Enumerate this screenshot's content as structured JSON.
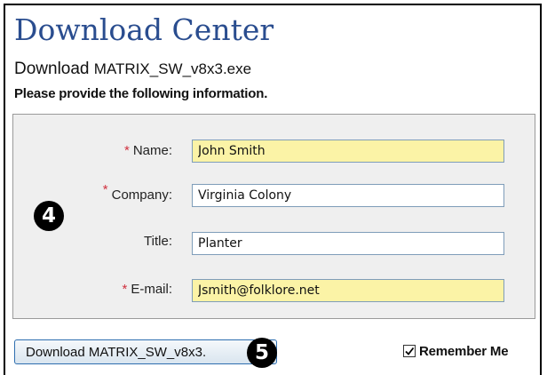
{
  "page": {
    "title": "Download Center",
    "download_prefix": "Download",
    "download_filename": "MATRIX_SW_v8x3.exe",
    "instructions": "Please provide the following information."
  },
  "form": {
    "required_marker": "*",
    "fields": [
      {
        "label": "Name:",
        "value": "John Smith",
        "required": true,
        "highlighted": true
      },
      {
        "label": "Company:",
        "value": "Virginia Colony",
        "required": true,
        "highlighted": false
      },
      {
        "label": "Title:",
        "value": "Planter",
        "required": false,
        "highlighted": false
      },
      {
        "label": "E-mail:",
        "value": "Jsmith@folklore.net",
        "required": true,
        "highlighted": true
      }
    ]
  },
  "callouts": {
    "form_step": "4",
    "button_step": "5"
  },
  "actions": {
    "download_button_label": "Download MATRIX_SW_v8x3.",
    "remember_me_label": "Remember Me",
    "remember_me_checked": true
  },
  "colors": {
    "title": "#2a4d8f",
    "required_marker": "#d0313f",
    "highlighted_field": "#fbf3a6",
    "panel_background": "#efefef"
  },
  "icons": {
    "checkbox": "checkmark-icon"
  }
}
